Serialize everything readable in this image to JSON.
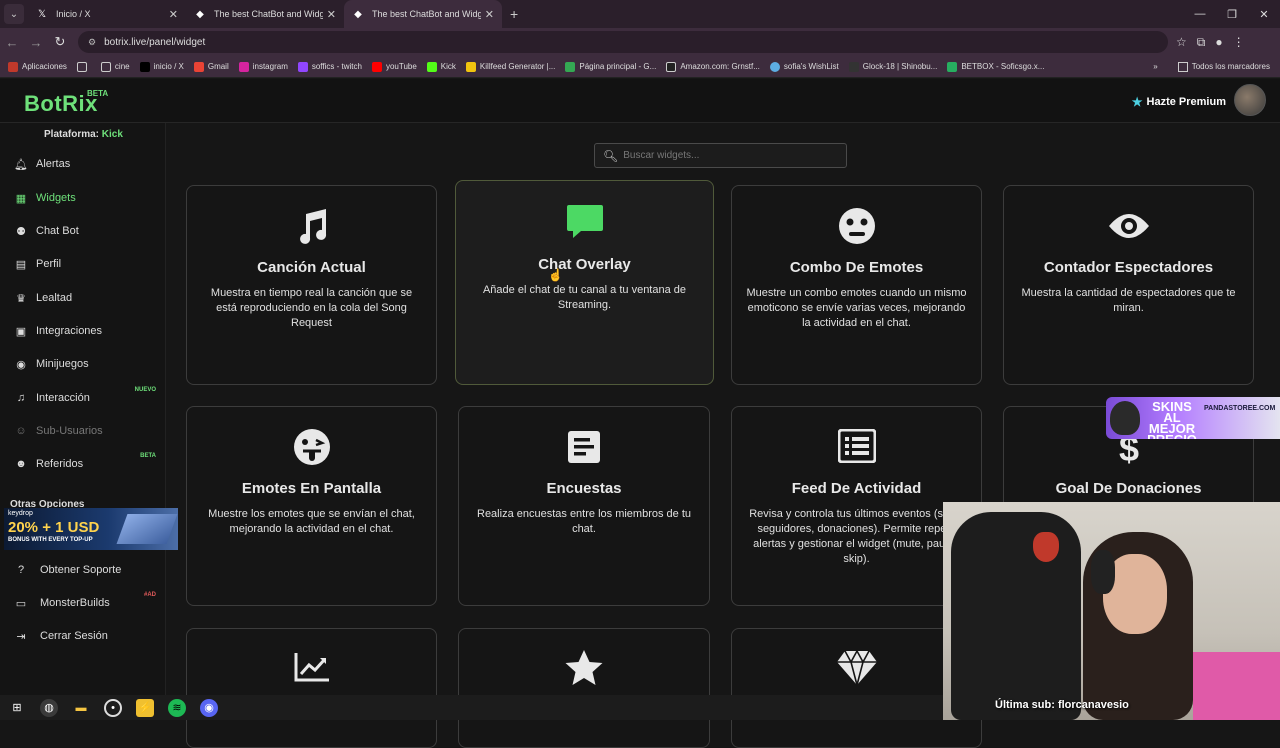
{
  "browser": {
    "tabs": [
      {
        "title": "Inicio / X",
        "icon": "x-logo-icon"
      },
      {
        "title": "The best ChatBot and Widgets",
        "icon": "botrix-favicon-icon"
      },
      {
        "title": "The best ChatBot and Widgets",
        "icon": "botrix-favicon-icon",
        "active": true
      }
    ],
    "url": "botrix.live/panel/widget",
    "bookmarks": [
      "Aplicaciones",
      "cine",
      "inicio / X",
      "Gmail",
      "instagram",
      "soffics - twitch",
      "youTube",
      "Kick",
      "Killfeed Generator |...",
      "Página principal - G...",
      "Amazon.com: Grnstf...",
      "sofia's WishList",
      "Glock-18 | Shinobu...",
      "BETBOX - Soficsgo.x..."
    ],
    "bookmarks_right": "Todos los marcadores"
  },
  "header": {
    "logo": "BotRix",
    "beta": "BETA",
    "premium": "Hazte Premium"
  },
  "sidebar": {
    "platform_label": "Plataforma:",
    "platform_value": "Kick",
    "items": [
      {
        "label": "Alertas",
        "icon": "bell-icon"
      },
      {
        "label": "Widgets",
        "icon": "grid-icon",
        "active": true
      },
      {
        "label": "Chat Bot",
        "icon": "robot-icon"
      },
      {
        "label": "Perfil",
        "icon": "id-card-icon"
      },
      {
        "label": "Lealtad",
        "icon": "trophy-icon"
      },
      {
        "label": "Integraciones",
        "icon": "plug-icon"
      },
      {
        "label": "Minijuegos",
        "icon": "gamepad-icon"
      },
      {
        "label": "Interacción",
        "icon": "music-icon",
        "tag": "NUEVO"
      },
      {
        "label": "Sub-Usuarios",
        "icon": "users-icon",
        "disabled": true
      },
      {
        "label": "Referidos",
        "icon": "users-group-icon",
        "tag": "BETA"
      }
    ],
    "otras_opciones": "Otras Opciones",
    "ad": {
      "brand": "keydrop",
      "headline": "20% + 1 USD",
      "sub": "BONUS WITH EVERY TOP-UP"
    },
    "bottom_items": [
      {
        "label": "Obtener Soporte",
        "icon": "question-icon"
      },
      {
        "label": "MonsterBuilds",
        "icon": "monitor-icon",
        "tag": "#AD"
      },
      {
        "label": "Cerrar Sesión",
        "icon": "logout-icon"
      }
    ]
  },
  "search": {
    "placeholder": "Buscar widgets..."
  },
  "widgets": [
    {
      "title": "Canción Actual",
      "desc": "Muestra en tiempo real la canción que se está reproduciendo en la cola del Song Request",
      "icon": "music-note-icon"
    },
    {
      "title": "Chat Overlay",
      "desc": "Añade el chat de tu canal a tu ventana de Streaming.",
      "icon": "chat-bubble-icon",
      "accent": "#4cd964"
    },
    {
      "title": "Combo De Emotes",
      "desc": "Muestre un combo emotes cuando un mismo emoticono se envíe varias veces, mejorando la actividad en el chat.",
      "icon": "surprised-face-icon"
    },
    {
      "title": "Contador Espectadores",
      "desc": "Muestra la cantidad de espectadores que te miran.",
      "icon": "eye-icon"
    },
    {
      "title": "Emotes En Pantalla",
      "desc": "Muestre los emotes que se envían el chat, mejorando la actividad en el chat.",
      "icon": "tongue-face-icon"
    },
    {
      "title": "Encuestas",
      "desc": "Realiza encuestas entre los miembros de tu chat.",
      "icon": "poll-icon"
    },
    {
      "title": "Feed De Actividad",
      "desc": "Revisa y controla tus últimos eventos (subs, seguidores, donaciones). Permite repetir alertas y gestionar el widget (mute, pausa, skip).",
      "icon": "list-icon"
    },
    {
      "title": "Goal De Donaciones",
      "desc": "",
      "icon": "dollar-icon"
    },
    {
      "title": "",
      "desc": "",
      "icon": "chart-line-icon"
    },
    {
      "title": "",
      "desc": "",
      "icon": "star-icon"
    },
    {
      "title": "",
      "desc": "",
      "icon": "diamond-icon"
    }
  ],
  "overlay": {
    "skins_ad": "SKINS AL MEJOR PRECIO",
    "skins_site": "PANDASTOREE.COM",
    "last_sub": "Última sub: florcanavesio"
  },
  "colors": {
    "accent": "#6ee07a",
    "chat_icon": "#4cd964"
  }
}
